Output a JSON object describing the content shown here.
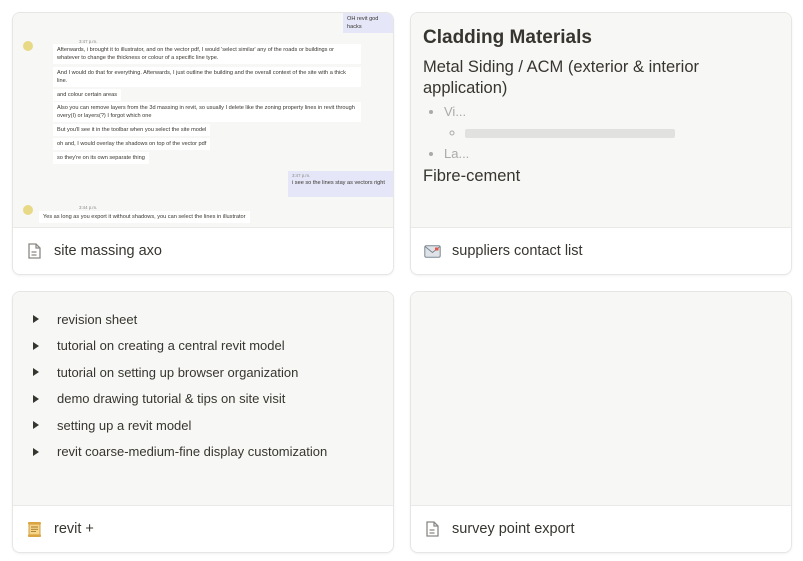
{
  "cards": [
    {
      "title": "site massing axo",
      "icon": "page-icon",
      "chat": {
        "top_message": "OH revit god hacks",
        "time_1": "3:47 p.m.",
        "messages_left": [
          "Afterwards, i brought it to illustrator, and on the vector pdf, I would 'select similar' any of the roads or buildings or whatever to change the thickness or colour of a specific line type.",
          "And I would do that for everything. Afterwards, I just outline the building and the overall context of the site with a thick line.",
          "and colour certain areas",
          "Also you can remove layers from the 3d massing in revit, so usually I delete like the zoning property lines in revit through overy(I) or layers(?) I forgot which one",
          "But you'll see it in the toolbar when you select the site model",
          "oh and, I would overlay the shadows on top of the vector pdf",
          "so they're on its own separate thing"
        ],
        "time_2": "3:47 p.m.",
        "reply": "i see so the lines stay as vectors right",
        "time_3": "3:44 p.m.",
        "last_message": "Yes as long as you export it without shadows, you can select the lines in illustrator"
      }
    },
    {
      "title": "suppliers contact list",
      "icon": "envelope-icon",
      "doc": {
        "heading": "Cladding Materials",
        "subheading": "Metal Siding / ACM (exterior & interior application)",
        "bullet_1": "Vi...",
        "bullet_2": "La...",
        "section": "Fibre-cement"
      }
    },
    {
      "title": "revit +",
      "icon": "scroll-icon",
      "toggles": [
        "revision sheet",
        "tutorial on creating a central revit model",
        "tutorial on setting up browser organization",
        "demo drawing tutorial & tips on site visit",
        "setting up a revit model",
        "revit coarse-medium-fine display customization"
      ]
    },
    {
      "title": "survey point export",
      "icon": "page-icon"
    }
  ]
}
